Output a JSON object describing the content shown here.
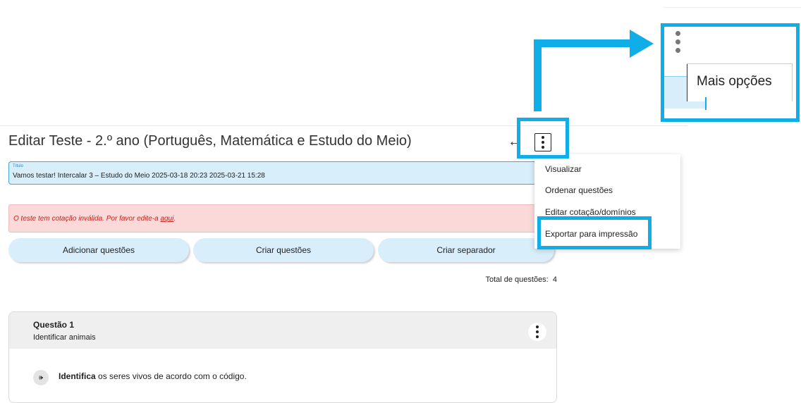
{
  "page": {
    "title": "Editar Teste - 2.º ano (Português, Matemática e Estudo do Meio)",
    "back_icon": "←"
  },
  "title_field": {
    "label": "Título",
    "value": "Vamos testar! Intercalar 3 – Estudo do Meio 2025-03-18 20:23 2025-03-21 15:28"
  },
  "error": {
    "message": "O teste tem cotação inválida. Por favor edite-a ",
    "link": "aqui",
    "suffix": "."
  },
  "actions": {
    "add_questions": "Adicionar questões",
    "create_questions": "Criar questões",
    "create_separator": "Criar separador"
  },
  "total": {
    "label": "Total de questões:",
    "value": "4"
  },
  "question": {
    "title": "Questão 1",
    "subtitle": "Identificar animais",
    "audio_icon": "🕪",
    "text_bold": "Identifica",
    "text_rest": " os seres vivos de acordo com o código."
  },
  "menu": {
    "items": [
      "Visualizar",
      "Ordenar questões",
      "Editar cotação/domínios",
      "Exportar para impressão"
    ]
  },
  "zoom": {
    "tooltip": "Mais opções"
  },
  "colors": {
    "annotation": "#10aee8",
    "field_bg": "#d8eefa",
    "error_bg": "#fbd9d9",
    "error_text": "#c0231c"
  }
}
